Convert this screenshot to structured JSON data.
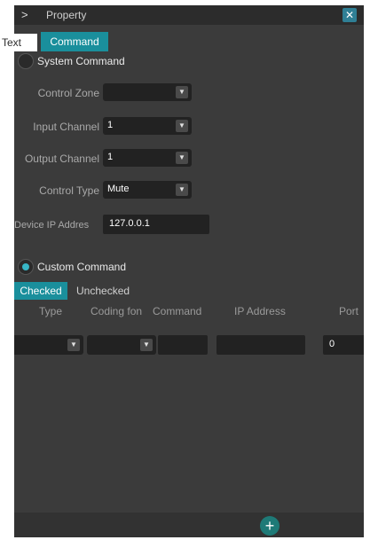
{
  "titlebar": {
    "title": "Property",
    "expand_glyph": ">",
    "close_glyph": "✕"
  },
  "tabs": [
    {
      "label": "Text",
      "active": false
    },
    {
      "label": "Command",
      "active": true
    }
  ],
  "system_command": {
    "label": "System Command",
    "selected": false,
    "fields": {
      "control_zone": {
        "label": "Control Zone",
        "value": ""
      },
      "input_channel": {
        "label": "Input Channel",
        "value": "1"
      },
      "output_channel": {
        "label": "Output Channel",
        "value": "1"
      },
      "control_type": {
        "label": "Control Type",
        "value": "Mute"
      },
      "device_ip": {
        "label": "Device IP Addres",
        "value": "127.0.0.1"
      }
    }
  },
  "custom_command": {
    "label": "Custom Command",
    "selected": true,
    "toggle": {
      "checked_label": "Checked",
      "unchecked_label": "Unchecked",
      "active": "Checked"
    },
    "columns": [
      "Type",
      "Coding fon",
      "Command",
      "IP Address",
      "Port"
    ],
    "row": {
      "type": "",
      "coding": "",
      "command": "",
      "ip": "",
      "port": "0"
    }
  },
  "footer": {
    "add_glyph": "+"
  },
  "colors": {
    "accent": "#1a8f9c",
    "panel_bg": "#3b3b3b",
    "field_bg": "#222222",
    "add_button": "#1e7a77"
  },
  "icons": {
    "expand": "chevron-right-icon",
    "close": "close-icon",
    "dropdown": "chevron-down-icon",
    "add": "plus-icon"
  }
}
